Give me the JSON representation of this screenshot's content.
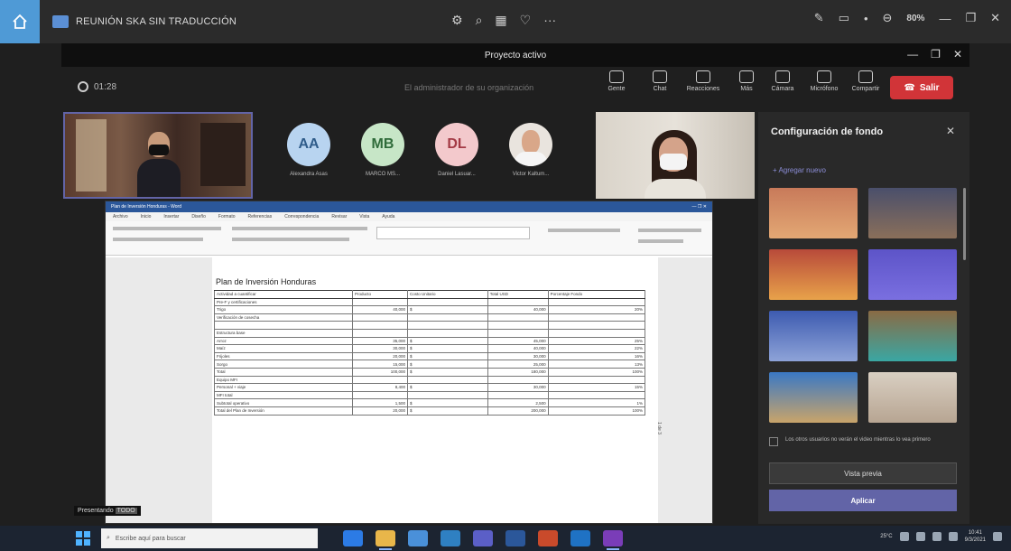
{
  "window": {
    "title": "REUNIÓN SKA SIN TRADUCCIÓN",
    "zoom_level": "80%",
    "window_controls": [
      "—",
      "❐",
      "✕"
    ]
  },
  "presenter_bar": {
    "label": "Proyecto activo",
    "controls": [
      "—",
      "❐",
      "✕"
    ]
  },
  "toolbar": {
    "timer": "01:28",
    "search_note": "El administrador de su organización",
    "tools": [
      {
        "label": "Gente",
        "icon": "people-icon"
      },
      {
        "label": "Chat",
        "icon": "chat-icon"
      },
      {
        "label": "Reacciones",
        "icon": "reactions-icon"
      },
      {
        "label": "Más",
        "icon": "more-icon"
      }
    ],
    "av_controls": [
      {
        "label": "Cámara",
        "icon": "camera-icon"
      },
      {
        "label": "Micrófono",
        "icon": "microphone-icon"
      },
      {
        "label": "Compartir",
        "icon": "share-icon"
      }
    ],
    "leave_label": "Salir"
  },
  "participants": [
    {
      "initials": "AA",
      "name": "Alexandra Asas",
      "bg": "#b8d4f0",
      "fg": "#2f5c8a"
    },
    {
      "initials": "MB",
      "name": "MARCO MS...",
      "bg": "#c7e6c7",
      "fg": "#2f6b3a"
    },
    {
      "initials": "DL",
      "name": "Daniel Lasuar...",
      "bg": "#f3c9cc",
      "fg": "#a33a45"
    },
    {
      "initials": "",
      "name": "Victor Kaltum...",
      "bg": "#e9e4de",
      "fg": "#333"
    }
  ],
  "document": {
    "app_title": "Plan de Inversión Honduras - Word",
    "tabs": [
      "Archivo",
      "Inicio",
      "Insertar",
      "Diseño",
      "Formato",
      "Referencias",
      "Correspondencia",
      "Revisar",
      "Vista",
      "Ayuda"
    ],
    "heading": "Plan de Inversión Honduras",
    "columns": [
      "Actividad a cuantificar",
      "Producto",
      "Costo Unitario",
      "Total USD",
      "Porcentaje Fondo"
    ],
    "rows": [
      {
        "section": true,
        "cells": [
          "Pre-F y certificaciones",
          "",
          "",
          "",
          ""
        ]
      },
      {
        "section": false,
        "cells": [
          "Trigo",
          "40,000",
          "$",
          "40,000",
          "20%"
        ]
      },
      {
        "section": false,
        "cells": [
          "Verificación de cosecha",
          "",
          "",
          "",
          ""
        ]
      },
      {
        "section": false,
        "cells": [
          "",
          "",
          "",
          "",
          ""
        ]
      },
      {
        "section": true,
        "cells": [
          "Estructura base",
          "",
          "",
          "",
          ""
        ]
      },
      {
        "section": false,
        "cells": [
          "Arroz",
          "35,000",
          "$",
          "45,000",
          "25%"
        ]
      },
      {
        "section": false,
        "cells": [
          "Maíz",
          "30,000",
          "$",
          "40,000",
          "22%"
        ]
      },
      {
        "section": false,
        "cells": [
          "Frijoles",
          "20,000",
          "$",
          "30,000",
          "16%"
        ]
      },
      {
        "section": false,
        "cells": [
          "Sorgo",
          "15,000",
          "$",
          "25,000",
          "13%"
        ]
      },
      {
        "section": false,
        "cells": [
          "Total",
          "100,000",
          "$",
          "180,000",
          "100%"
        ]
      },
      {
        "section": true,
        "cells": [
          "Equipo MFI",
          "",
          "",
          "",
          ""
        ]
      },
      {
        "section": false,
        "cells": [
          "Personal + viaje",
          "8,400",
          "$",
          "30,000",
          "15%"
        ]
      },
      {
        "section": true,
        "cells": [
          "MFI total",
          "",
          "",
          "",
          ""
        ]
      },
      {
        "section": false,
        "cells": [
          "Subtotal operativo",
          "1,500",
          "$",
          "2,500",
          "1%"
        ]
      },
      {
        "section": true,
        "cells": [
          "Total del Plan de Inversión",
          "20,000",
          "$",
          "200,000",
          "100%"
        ]
      }
    ]
  },
  "presenter_label": {
    "prefix": "Presentando",
    "name": "TODO"
  },
  "background_panel": {
    "title": "Configuración de fondo",
    "add_new": "+ Agregar nuevo",
    "thumbnails": [
      {
        "name": "bg-desert-sunset",
        "top": "#c87a5a",
        "bottom": "#e3a874"
      },
      {
        "name": "bg-office-room",
        "top": "#4a4f6b",
        "bottom": "#8a6f5a"
      },
      {
        "name": "bg-red-arches",
        "top": "#b84a3a",
        "bottom": "#e8a24a"
      },
      {
        "name": "bg-purple-space",
        "top": "#5d54c8",
        "bottom": "#7a6fe0"
      },
      {
        "name": "bg-blue-pattern",
        "top": "#3d5bb0",
        "bottom": "#8ea3d8"
      },
      {
        "name": "bg-patio-pool",
        "top": "#8a6a44",
        "bottom": "#3aa7a3"
      },
      {
        "name": "bg-city-sky",
        "top": "#3a78c4",
        "bottom": "#c9a46a"
      },
      {
        "name": "bg-minimal-room",
        "top": "#d9cfc2",
        "bottom": "#b7a592"
      }
    ],
    "checkbox_label": "Los otros usuarios no verán el video mientras lo vea primero",
    "preview_label": "Vista previa",
    "apply_label": "Aplicar"
  },
  "taskbar": {
    "search_placeholder": "Escribe aquí para buscar",
    "apps": [
      {
        "name": "edge-app",
        "color": "#2c7be5",
        "active": false
      },
      {
        "name": "explorer-app",
        "color": "#e8b64a",
        "active": true
      },
      {
        "name": "store-app",
        "color": "#4a90d9",
        "active": false
      },
      {
        "name": "mail-app",
        "color": "#2f80c2",
        "active": false
      },
      {
        "name": "teams-app",
        "color": "#5b5fc7",
        "active": false
      },
      {
        "name": "word-app",
        "color": "#2b579a",
        "active": false
      },
      {
        "name": "powerpoint-app",
        "color": "#c94a2b",
        "active": false
      },
      {
        "name": "outlook-app",
        "color": "#1f72c4",
        "active": false
      },
      {
        "name": "onenote-app",
        "color": "#7a3db8",
        "active": true
      }
    ],
    "weather": "25°C",
    "time": "10:41",
    "date": "9/3/2021"
  }
}
